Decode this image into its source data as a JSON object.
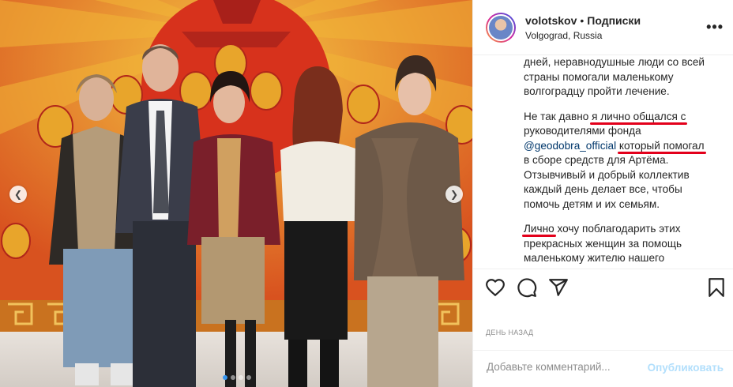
{
  "post": {
    "username": "volotskov",
    "separator": "•",
    "follow_label": "Подписки",
    "location": "Volgograd, Russia",
    "more_label": "•••"
  },
  "caption": {
    "p1": [
      "дней, неравнодушные люди со всей",
      "страны помогали маленькому",
      "волгоградцу пройти лечение."
    ],
    "p2_l1_a": "Не так давно ",
    "p2_l1_b": "я лично общался с",
    "p2_l2": "руководителями фонда",
    "p2_l3_mention": "@geodobra_official",
    "p2_l3_sp": " ",
    "p2_l3_b": "который помогал",
    "p2_rest": [
      "в сборе средств для Артёма.",
      "Отзывчивый и добрый коллектив",
      "каждый день делает все, чтобы",
      "помочь детям и их семьям."
    ],
    "p3_l1_a": "Лично",
    "p3_l1_b": " хочу поблагодарить этих",
    "p3_l2": "прекрасных женщин за помощь",
    "p3_l3": "маленькому жителю нашего"
  },
  "meta": {
    "time": "ДЕНЬ НАЗАД"
  },
  "comment": {
    "placeholder": "Добавьте комментарий...",
    "post_label": "Опубликовать"
  },
  "carousel": {
    "prev_icon": "chevron-left-icon",
    "next_icon": "chevron-right-icon",
    "slides": 4,
    "active": 1,
    "prev_glyph": "❮",
    "next_glyph": "❯"
  },
  "icons": [
    "heart-icon",
    "comment-icon",
    "share-icon",
    "bookmark-icon"
  ]
}
